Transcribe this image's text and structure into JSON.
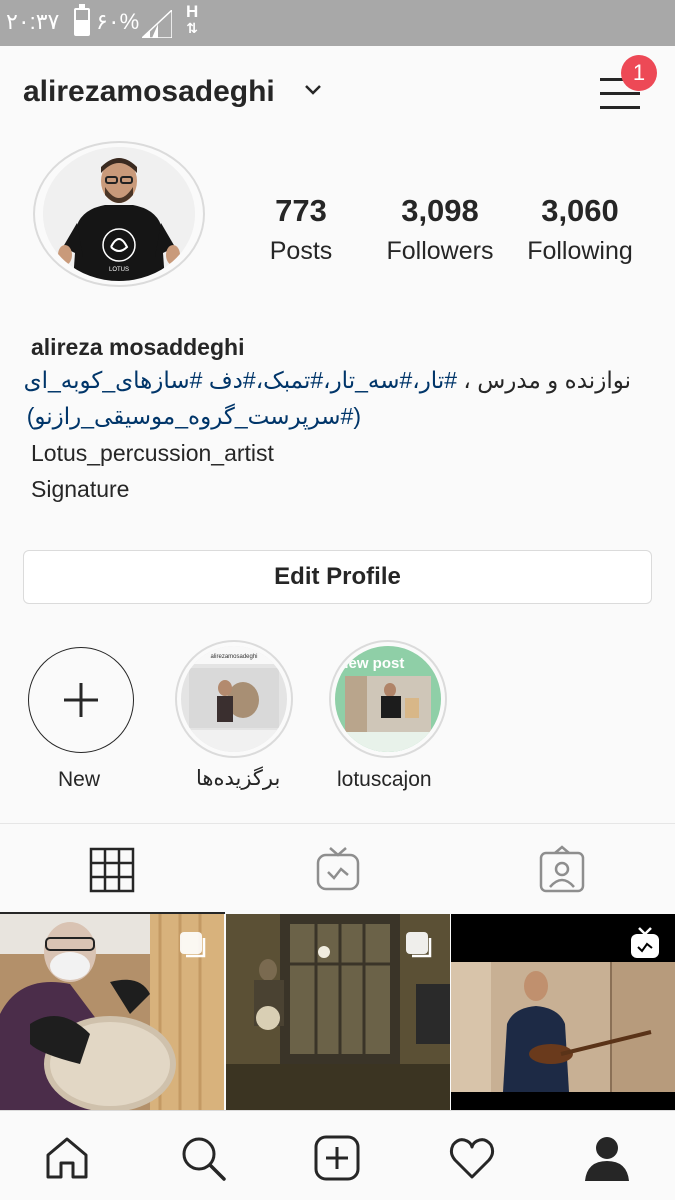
{
  "status_bar": {
    "time": "۲۰:۳۷",
    "battery_text": "۶۰%",
    "battery_level": 0.6,
    "network": "H"
  },
  "profile": {
    "username": "alirezamosadeghi",
    "notification_count": "1",
    "stats": [
      {
        "value": "773",
        "label": "Posts"
      },
      {
        "value": "3,098",
        "label": "Followers"
      },
      {
        "value": "3,060",
        "label": "Following"
      }
    ],
    "full_name": "alireza mosaddeghi",
    "bio_line1_plain": "نوازنده و مدرس ،",
    "bio_line1_tags": "#تار،#سه_تار،#تمبک،#دف #سازهای_کوبه_ای",
    "bio_line2": "(#سرپرست_گروه_موسیقی_رازنو)",
    "bio_line3": "Lotus_percussion_artist",
    "bio_line4": "Signature",
    "edit_profile_label": "Edit Profile"
  },
  "highlights": [
    {
      "label": "New",
      "icon": "plus-icon"
    },
    {
      "label": "برگزیده‌ها",
      "cover_text": "alirezamosadeghi"
    },
    {
      "label": "lotuscajon",
      "cover_text": "New post"
    }
  ],
  "tabs": [
    {
      "name": "grid",
      "icon": "grid-icon",
      "active": true
    },
    {
      "name": "igtv",
      "icon": "igtv-icon",
      "active": false
    },
    {
      "name": "tagged",
      "icon": "tagged-icon",
      "active": false
    }
  ],
  "posts": [
    {
      "type": "multi",
      "badge_icon": "carousel-icon"
    },
    {
      "type": "multi",
      "badge_icon": "carousel-icon"
    },
    {
      "type": "igtv",
      "badge_icon": "igtv-icon"
    }
  ],
  "bottom_nav": [
    {
      "name": "home",
      "icon": "home-icon"
    },
    {
      "name": "search",
      "icon": "search-icon"
    },
    {
      "name": "new-post",
      "icon": "add-post-icon"
    },
    {
      "name": "activity",
      "icon": "heart-icon"
    },
    {
      "name": "profile",
      "icon": "profile-icon"
    }
  ],
  "colors": {
    "badge": "#ed4956",
    "link": "#003569",
    "status_bar": "#a8a8a8"
  }
}
